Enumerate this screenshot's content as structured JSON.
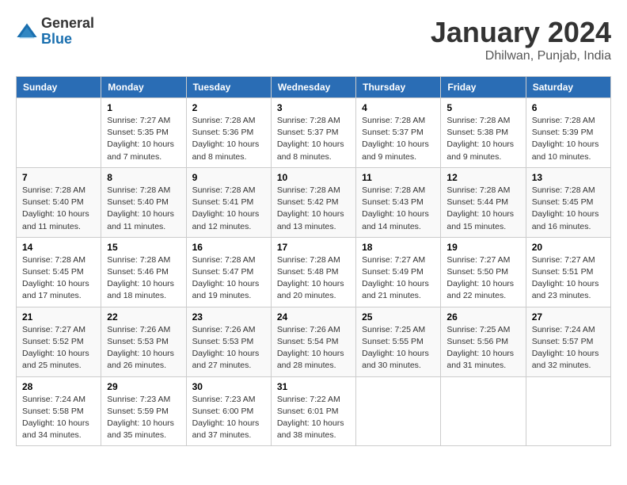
{
  "logo": {
    "general": "General",
    "blue": "Blue"
  },
  "title": {
    "month_year": "January 2024",
    "location": "Dhilwan, Punjab, India"
  },
  "headers": [
    "Sunday",
    "Monday",
    "Tuesday",
    "Wednesday",
    "Thursday",
    "Friday",
    "Saturday"
  ],
  "weeks": [
    [
      {
        "day": "",
        "info": ""
      },
      {
        "day": "1",
        "info": "Sunrise: 7:27 AM\nSunset: 5:35 PM\nDaylight: 10 hours\nand 7 minutes."
      },
      {
        "day": "2",
        "info": "Sunrise: 7:28 AM\nSunset: 5:36 PM\nDaylight: 10 hours\nand 8 minutes."
      },
      {
        "day": "3",
        "info": "Sunrise: 7:28 AM\nSunset: 5:37 PM\nDaylight: 10 hours\nand 8 minutes."
      },
      {
        "day": "4",
        "info": "Sunrise: 7:28 AM\nSunset: 5:37 PM\nDaylight: 10 hours\nand 9 minutes."
      },
      {
        "day": "5",
        "info": "Sunrise: 7:28 AM\nSunset: 5:38 PM\nDaylight: 10 hours\nand 9 minutes."
      },
      {
        "day": "6",
        "info": "Sunrise: 7:28 AM\nSunset: 5:39 PM\nDaylight: 10 hours\nand 10 minutes."
      }
    ],
    [
      {
        "day": "7",
        "info": "Sunrise: 7:28 AM\nSunset: 5:40 PM\nDaylight: 10 hours\nand 11 minutes."
      },
      {
        "day": "8",
        "info": "Sunrise: 7:28 AM\nSunset: 5:40 PM\nDaylight: 10 hours\nand 11 minutes."
      },
      {
        "day": "9",
        "info": "Sunrise: 7:28 AM\nSunset: 5:41 PM\nDaylight: 10 hours\nand 12 minutes."
      },
      {
        "day": "10",
        "info": "Sunrise: 7:28 AM\nSunset: 5:42 PM\nDaylight: 10 hours\nand 13 minutes."
      },
      {
        "day": "11",
        "info": "Sunrise: 7:28 AM\nSunset: 5:43 PM\nDaylight: 10 hours\nand 14 minutes."
      },
      {
        "day": "12",
        "info": "Sunrise: 7:28 AM\nSunset: 5:44 PM\nDaylight: 10 hours\nand 15 minutes."
      },
      {
        "day": "13",
        "info": "Sunrise: 7:28 AM\nSunset: 5:45 PM\nDaylight: 10 hours\nand 16 minutes."
      }
    ],
    [
      {
        "day": "14",
        "info": "Sunrise: 7:28 AM\nSunset: 5:45 PM\nDaylight: 10 hours\nand 17 minutes."
      },
      {
        "day": "15",
        "info": "Sunrise: 7:28 AM\nSunset: 5:46 PM\nDaylight: 10 hours\nand 18 minutes."
      },
      {
        "day": "16",
        "info": "Sunrise: 7:28 AM\nSunset: 5:47 PM\nDaylight: 10 hours\nand 19 minutes."
      },
      {
        "day": "17",
        "info": "Sunrise: 7:28 AM\nSunset: 5:48 PM\nDaylight: 10 hours\nand 20 minutes."
      },
      {
        "day": "18",
        "info": "Sunrise: 7:27 AM\nSunset: 5:49 PM\nDaylight: 10 hours\nand 21 minutes."
      },
      {
        "day": "19",
        "info": "Sunrise: 7:27 AM\nSunset: 5:50 PM\nDaylight: 10 hours\nand 22 minutes."
      },
      {
        "day": "20",
        "info": "Sunrise: 7:27 AM\nSunset: 5:51 PM\nDaylight: 10 hours\nand 23 minutes."
      }
    ],
    [
      {
        "day": "21",
        "info": "Sunrise: 7:27 AM\nSunset: 5:52 PM\nDaylight: 10 hours\nand 25 minutes."
      },
      {
        "day": "22",
        "info": "Sunrise: 7:26 AM\nSunset: 5:53 PM\nDaylight: 10 hours\nand 26 minutes."
      },
      {
        "day": "23",
        "info": "Sunrise: 7:26 AM\nSunset: 5:53 PM\nDaylight: 10 hours\nand 27 minutes."
      },
      {
        "day": "24",
        "info": "Sunrise: 7:26 AM\nSunset: 5:54 PM\nDaylight: 10 hours\nand 28 minutes."
      },
      {
        "day": "25",
        "info": "Sunrise: 7:25 AM\nSunset: 5:55 PM\nDaylight: 10 hours\nand 30 minutes."
      },
      {
        "day": "26",
        "info": "Sunrise: 7:25 AM\nSunset: 5:56 PM\nDaylight: 10 hours\nand 31 minutes."
      },
      {
        "day": "27",
        "info": "Sunrise: 7:24 AM\nSunset: 5:57 PM\nDaylight: 10 hours\nand 32 minutes."
      }
    ],
    [
      {
        "day": "28",
        "info": "Sunrise: 7:24 AM\nSunset: 5:58 PM\nDaylight: 10 hours\nand 34 minutes."
      },
      {
        "day": "29",
        "info": "Sunrise: 7:23 AM\nSunset: 5:59 PM\nDaylight: 10 hours\nand 35 minutes."
      },
      {
        "day": "30",
        "info": "Sunrise: 7:23 AM\nSunset: 6:00 PM\nDaylight: 10 hours\nand 37 minutes."
      },
      {
        "day": "31",
        "info": "Sunrise: 7:22 AM\nSunset: 6:01 PM\nDaylight: 10 hours\nand 38 minutes."
      },
      {
        "day": "",
        "info": ""
      },
      {
        "day": "",
        "info": ""
      },
      {
        "day": "",
        "info": ""
      }
    ]
  ]
}
